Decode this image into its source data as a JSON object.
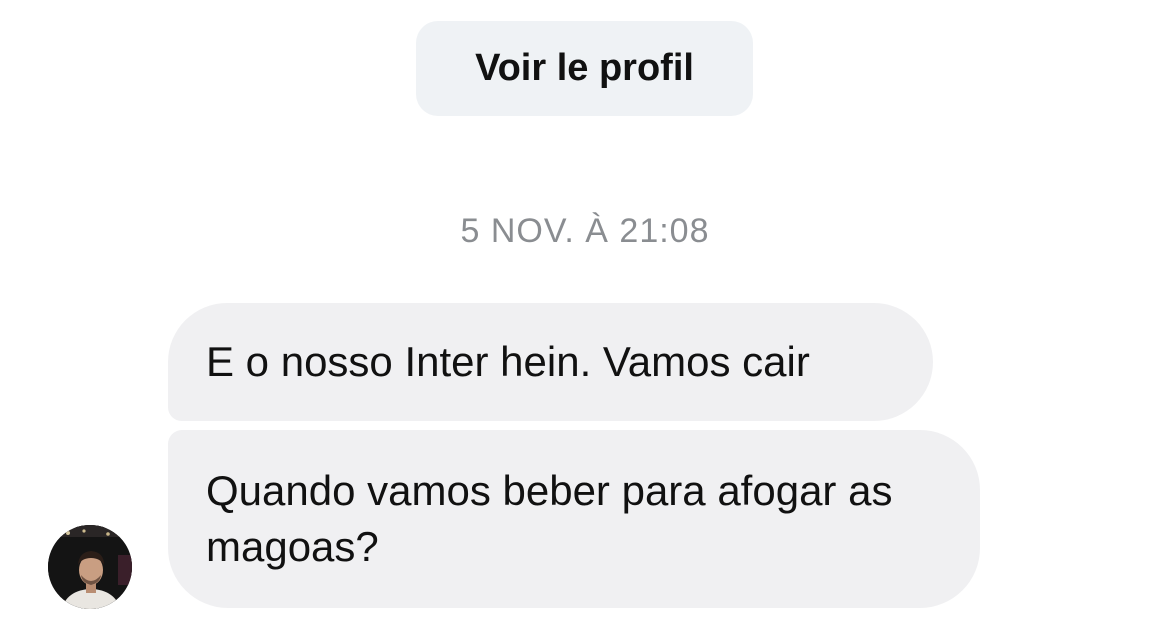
{
  "header": {
    "view_profile_label": "Voir le profil"
  },
  "conversation": {
    "timestamp": "5 NOV. À 21:08",
    "messages": [
      {
        "text": "E o nosso Inter hein. Vamos cair"
      },
      {
        "text": "Quando vamos beber para afogar as magoas?"
      }
    ],
    "sender": {
      "avatar_icon": "user-photo-avatar"
    }
  },
  "colors": {
    "bubble_background": "#f0f0f2",
    "profile_button_background": "#eff2f5",
    "timestamp_text": "#8a8d91",
    "message_text": "#111111"
  }
}
